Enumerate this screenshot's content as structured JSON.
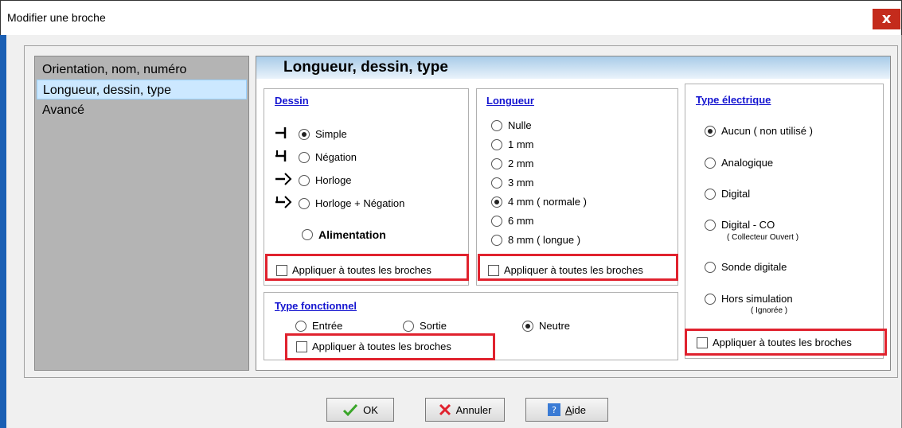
{
  "window": {
    "title": "Modifier une broche",
    "close_label": "x"
  },
  "sidebar": {
    "items": [
      {
        "label": "Orientation, nom, numéro",
        "selected": false
      },
      {
        "label": "Longueur, dessin, type",
        "selected": true
      },
      {
        "label": "Avancé",
        "selected": false
      }
    ]
  },
  "content": {
    "header": "Longueur, dessin, type"
  },
  "dessin": {
    "title": "Dessin",
    "options": [
      {
        "label": "Simple",
        "checked": true,
        "icon": "pin-simple-icon"
      },
      {
        "label": "Négation",
        "checked": false,
        "icon": "pin-negation-icon"
      },
      {
        "label": "Horloge",
        "checked": false,
        "icon": "pin-clock-icon"
      },
      {
        "label": "Horloge + Négation",
        "checked": false,
        "icon": "pin-clock-negation-icon"
      },
      {
        "label": "Alimentation",
        "checked": false,
        "icon": ""
      }
    ],
    "apply_all": "Appliquer à toutes les broches"
  },
  "longueur": {
    "title": "Longueur",
    "options": [
      {
        "label": "Nulle",
        "checked": false
      },
      {
        "label": "1 mm",
        "checked": false
      },
      {
        "label": "2 mm",
        "checked": false
      },
      {
        "label": "3 mm",
        "checked": false
      },
      {
        "label": "4 mm ( normale )",
        "checked": true
      },
      {
        "label": "6 mm",
        "checked": false
      },
      {
        "label": "8 mm ( longue )",
        "checked": false
      }
    ],
    "apply_all": "Appliquer à toutes les broches"
  },
  "type_electrique": {
    "title": "Type électrique",
    "options": [
      {
        "label": "Aucun ( non utilisé )",
        "checked": true,
        "sub": ""
      },
      {
        "label": "Analogique",
        "checked": false,
        "sub": ""
      },
      {
        "label": "Digital",
        "checked": false,
        "sub": ""
      },
      {
        "label": "Digital - CO",
        "checked": false,
        "sub": "( Collecteur Ouvert )"
      },
      {
        "label": "Sonde digitale",
        "checked": false,
        "sub": ""
      },
      {
        "label": "Hors simulation",
        "checked": false,
        "sub": "( Ignorée )"
      }
    ],
    "apply_all": "Appliquer à toutes les broches"
  },
  "type_fonctionnel": {
    "title": "Type fonctionnel",
    "options": [
      {
        "label": "Entrée",
        "checked": false
      },
      {
        "label": "Sortie",
        "checked": false
      },
      {
        "label": "Neutre",
        "checked": true
      }
    ],
    "apply_all": "Appliquer à toutes les broches"
  },
  "buttons": {
    "ok": "OK",
    "cancel": "Annuler",
    "help": "Aide",
    "help_mnemonic": "A"
  },
  "colors": {
    "accent": "#1515d0",
    "highlight": "#e0222e",
    "titlebar_close": "#c42b1c",
    "frame_left": "#1a5fb4"
  }
}
